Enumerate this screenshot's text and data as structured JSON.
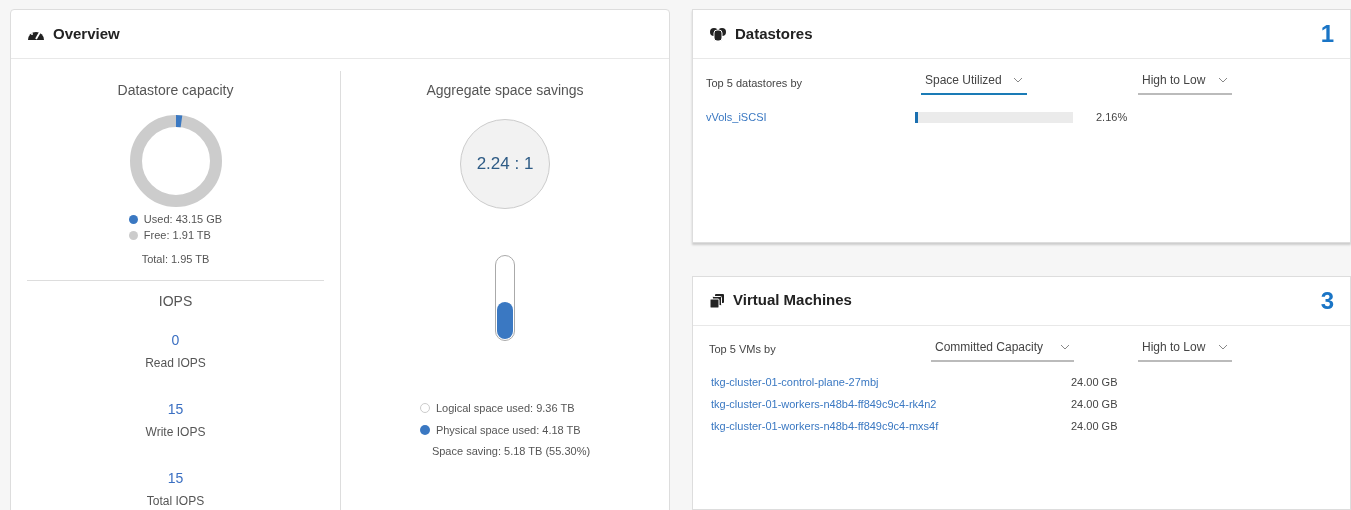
{
  "overview": {
    "title": "Overview",
    "capacity": {
      "title": "Datastore capacity",
      "legend": [
        {
          "label": "Used: 43.15 GB",
          "color": "#3a78c2"
        },
        {
          "label": "Free: 1.91 TB",
          "color": "#cccccc"
        }
      ],
      "total": "Total: 1.95 TB"
    },
    "iops": {
      "title": "IOPS",
      "items": [
        {
          "value": "0",
          "label": "Read IOPS"
        },
        {
          "value": "15",
          "label": "Write IOPS"
        },
        {
          "value": "15",
          "label": "Total IOPS"
        }
      ]
    },
    "savings": {
      "title": "Aggregate space savings",
      "ratio": "2.24 : 1",
      "level": 0.45,
      "legend": [
        {
          "label": "Logical space used: 9.36 TB",
          "filled": false
        },
        {
          "label": "Physical space used: 4.18 TB",
          "filled": true
        }
      ],
      "saving": "Space saving: 5.18 TB (55.30%)"
    }
  },
  "datastores": {
    "title": "Datastores",
    "count": "1",
    "by_label": "Top 5 datastores by",
    "dropdowns": [
      {
        "value": "Space Utilized",
        "focused": true
      },
      {
        "value": "High to Low",
        "focused": false
      }
    ],
    "rows": [
      {
        "name": "vVols_iSCSI",
        "level": 0.0216,
        "reading": "2.16%"
      }
    ]
  },
  "virtual_machines": {
    "title": "Virtual Machines",
    "count": "3",
    "by_label": "Top 5 VMs by",
    "dropdowns": [
      {
        "value": "Committed Capacity",
        "focused": false
      },
      {
        "value": "High to Low",
        "focused": false
      }
    ],
    "rows": [
      {
        "name": "tkg-cluster-01-control-plane-27mbj",
        "reading": "24.00 GB"
      },
      {
        "name": "tkg-cluster-01-workers-n48b4-ff849c9c4-rk4n2",
        "reading": "24.00 GB"
      },
      {
        "name": "tkg-cluster-01-workers-n48b4-ff849c9c4-mxs4f",
        "reading": "24.00 GB"
      }
    ]
  }
}
